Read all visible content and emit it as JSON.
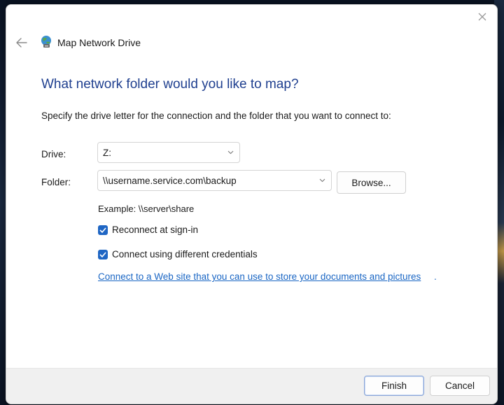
{
  "window": {
    "title": "Map Network Drive",
    "close_icon": "close-icon",
    "back_icon": "back-arrow-icon",
    "app_icon": "network-drive-icon"
  },
  "main": {
    "heading": "What network folder would you like to map?",
    "instructions": "Specify the drive letter for the connection and the folder that you want to connect to:",
    "drive": {
      "label": "Drive:",
      "value": "Z:"
    },
    "folder": {
      "label": "Folder:",
      "value": "\\\\username.service.com\\backup"
    },
    "browse_label": "Browse...",
    "example": "Example: \\\\server\\share",
    "reconnect": {
      "label": "Reconnect at sign-in",
      "checked": true
    },
    "credentials": {
      "label": "Connect using different credentials",
      "checked": true
    },
    "web_link": "Connect to a Web site that you can use to store your documents and pictures",
    "web_link_suffix": "."
  },
  "footer": {
    "finish_label": "Finish",
    "cancel_label": "Cancel"
  },
  "colors": {
    "heading": "#1f3f8f",
    "accent": "#1f66c4",
    "link": "#1a66c4"
  }
}
